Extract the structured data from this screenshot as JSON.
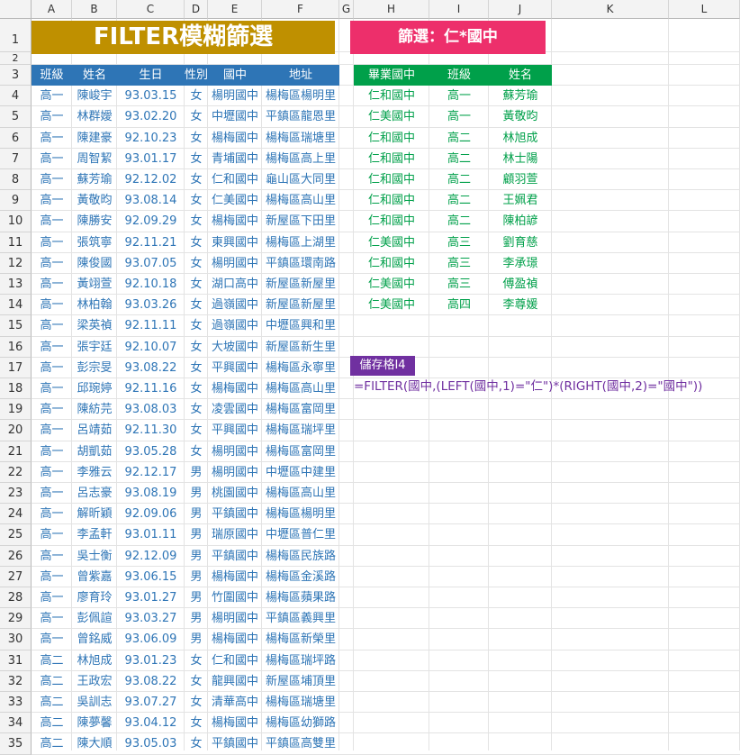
{
  "columns": [
    {
      "label": "A",
      "w": 45
    },
    {
      "label": "B",
      "w": 50
    },
    {
      "label": "C",
      "w": 75
    },
    {
      "label": "D",
      "w": 26
    },
    {
      "label": "E",
      "w": 60
    },
    {
      "label": "F",
      "w": 86
    },
    {
      "label": "G",
      "w": 16
    },
    {
      "label": "H",
      "w": 84
    },
    {
      "label": "I",
      "w": 66
    },
    {
      "label": "J",
      "w": 70
    },
    {
      "label": "K",
      "w": 130
    },
    {
      "label": "L",
      "w": 79
    }
  ],
  "title": {
    "text": "FILTER模糊篩選",
    "bg": "#bf9000"
  },
  "filter_title": {
    "text": "篩選：仁*國中",
    "bg": "#ed2f6b"
  },
  "left_headers": [
    "班級",
    "姓名",
    "生日",
    "性別",
    "國中",
    "地址"
  ],
  "left_rows": [
    [
      "高一",
      "陳峻宇",
      "93.03.15",
      "女",
      "楊明國中",
      "楊梅區楊明里"
    ],
    [
      "高一",
      "林群嬡",
      "93.02.20",
      "女",
      "中壢國中",
      "平鎮區龍恩里"
    ],
    [
      "高一",
      "陳建豪",
      "92.10.23",
      "女",
      "楊梅國中",
      "楊梅區瑞塘里"
    ],
    [
      "高一",
      "周智絜",
      "93.01.17",
      "女",
      "青埔國中",
      "楊梅區高上里"
    ],
    [
      "高一",
      "蘇芳瑜",
      "92.12.02",
      "女",
      "仁和國中",
      "龜山區大同里"
    ],
    [
      "高一",
      "黃敬昀",
      "93.08.14",
      "女",
      "仁美國中",
      "楊梅區高山里"
    ],
    [
      "高一",
      "陳勝安",
      "92.09.29",
      "女",
      "楊梅國中",
      "新屋區下田里"
    ],
    [
      "高一",
      "張筑寧",
      "92.11.21",
      "女",
      "東興國中",
      "楊梅區上湖里"
    ],
    [
      "高一",
      "陳俊國",
      "93.07.05",
      "女",
      "楊明國中",
      "平鎮區環南路"
    ],
    [
      "高一",
      "黃翊萱",
      "92.10.18",
      "女",
      "湖口高中",
      "新屋區新屋里"
    ],
    [
      "高一",
      "林柏翰",
      "93.03.26",
      "女",
      "過嶺國中",
      "新屋區新屋里"
    ],
    [
      "高一",
      "梁英禎",
      "92.11.11",
      "女",
      "過嶺國中",
      "中壢區興和里"
    ],
    [
      "高一",
      "張宇廷",
      "92.10.07",
      "女",
      "大坡國中",
      "新屋區新生里"
    ],
    [
      "高一",
      "彭宗旻",
      "93.08.22",
      "女",
      "平興國中",
      "楊梅區永寧里"
    ],
    [
      "高一",
      "邱琬婷",
      "92.11.16",
      "女",
      "楊梅國中",
      "楊梅區高山里"
    ],
    [
      "高一",
      "陳紡芫",
      "93.08.03",
      "女",
      "凌雲國中",
      "楊梅區富岡里"
    ],
    [
      "高一",
      "呂靖茹",
      "92.11.30",
      "女",
      "平興國中",
      "楊梅區瑞坪里"
    ],
    [
      "高一",
      "胡凱茹",
      "93.05.28",
      "女",
      "楊明國中",
      "楊梅區富岡里"
    ],
    [
      "高一",
      "李雅云",
      "92.12.17",
      "男",
      "楊明國中",
      "中壢區中建里"
    ],
    [
      "高一",
      "呂志豪",
      "93.08.19",
      "男",
      "桃園國中",
      "楊梅區高山里"
    ],
    [
      "高一",
      "解昕穎",
      "92.09.06",
      "男",
      "平鎮國中",
      "楊梅區楊明里"
    ],
    [
      "高一",
      "李孟軒",
      "93.01.11",
      "男",
      "瑞原國中",
      "中壢區普仁里"
    ],
    [
      "高一",
      "吳士衡",
      "92.12.09",
      "男",
      "平鎮國中",
      "楊梅區民族路"
    ],
    [
      "高一",
      "曾紫嘉",
      "93.06.15",
      "男",
      "楊梅國中",
      "楊梅區金溪路"
    ],
    [
      "高一",
      "廖育玲",
      "93.01.27",
      "男",
      "竹圍國中",
      "楊梅區蘋果路"
    ],
    [
      "高一",
      "彭佩諠",
      "93.03.27",
      "男",
      "楊明國中",
      "平鎮區義興里"
    ],
    [
      "高一",
      "曾銘威",
      "93.06.09",
      "男",
      "楊梅國中",
      "楊梅區新榮里"
    ],
    [
      "高二",
      "林旭成",
      "93.01.23",
      "女",
      "仁和國中",
      "楊梅區瑞坪路"
    ],
    [
      "高二",
      "王政宏",
      "93.08.22",
      "女",
      "龍興國中",
      "新屋區埔頂里"
    ],
    [
      "高二",
      "吳訓志",
      "93.07.27",
      "女",
      "清華高中",
      "楊梅區瑞塘里"
    ],
    [
      "高二",
      "陳夢馨",
      "93.04.12",
      "女",
      "楊梅國中",
      "楊梅區幼獅路"
    ],
    [
      "高二",
      "陳大順",
      "93.05.03",
      "女",
      "平鎮國中",
      "平鎮區高雙里"
    ]
  ],
  "right_headers": [
    "畢業國中",
    "班級",
    "姓名"
  ],
  "right_rows": [
    [
      "仁和國中",
      "高一",
      "蘇芳瑜"
    ],
    [
      "仁美國中",
      "高一",
      "黃敬昀"
    ],
    [
      "仁和國中",
      "高二",
      "林旭成"
    ],
    [
      "仁和國中",
      "高二",
      "林士陽"
    ],
    [
      "仁和國中",
      "高二",
      "顧羽萱"
    ],
    [
      "仁和國中",
      "高二",
      "王姵君"
    ],
    [
      "仁和國中",
      "高二",
      "陳柏諺"
    ],
    [
      "仁美國中",
      "高三",
      "劉育慈"
    ],
    [
      "仁和國中",
      "高三",
      "李承璟"
    ],
    [
      "仁美國中",
      "高三",
      "傅盈禎"
    ],
    [
      "仁美國中",
      "高四",
      "李尊媛"
    ]
  ],
  "cell_label": {
    "text": "儲存格I4",
    "bg": "#7030a0"
  },
  "formula": {
    "text": "=FILTER(國中,(LEFT(國中,1)=\"仁\")*(RIGHT(國中,2)=\"國中\"))",
    "color": "#7030a0"
  }
}
